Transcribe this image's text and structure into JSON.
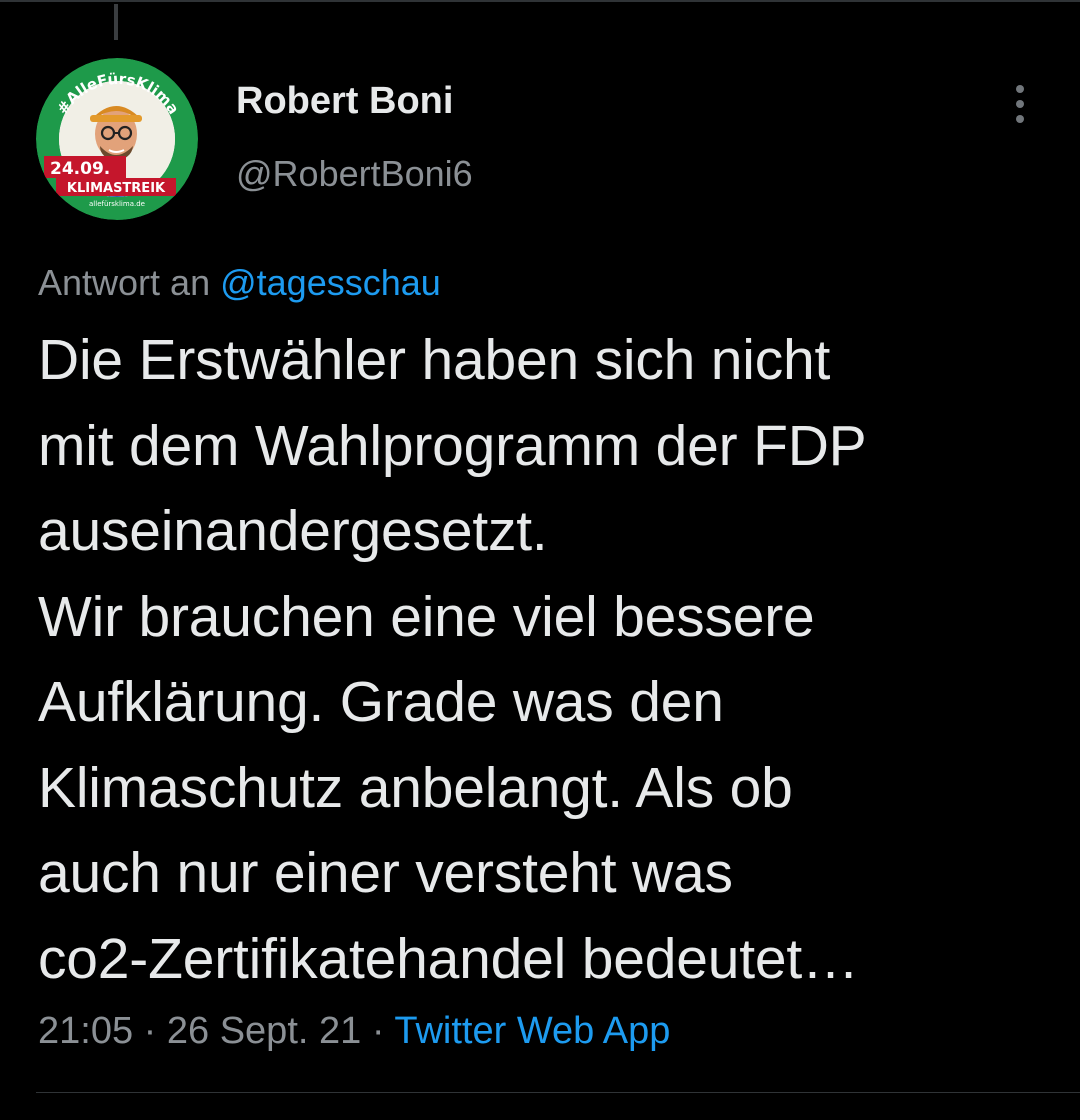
{
  "author": {
    "name": "Robert Boni",
    "handle": "@RobertBoni6",
    "avatar": {
      "badge_text": "#AlleFürsKlima",
      "date_text": "24.09.",
      "strike_text": "KLIMASTREIK",
      "url_text": "allefürsklima.de",
      "ring_color": "#1e9a4a",
      "accent_color": "#c5162c"
    }
  },
  "more_menu": {
    "icon": "more-vertical-icon"
  },
  "reply_context": {
    "prefix": "Antwort an",
    "mention": "@tagesschau"
  },
  "tweet": {
    "lines": [
      "Die Erstwähler haben sich nicht",
      "mit dem Wahlprogramm der FDP",
      "auseinandergesetzt.",
      "Wir brauchen eine viel bessere",
      "Aufklärung. Grade was den",
      "Klimaschutz anbelangt. Als ob",
      "auch nur einer versteht was",
      "co2-Zertifikatehandel bedeutet…"
    ]
  },
  "meta": {
    "time": "21:05",
    "separator": "·",
    "date": "26 Sept. 21",
    "source": "Twitter Web App"
  },
  "colors": {
    "background": "#000000",
    "text_primary": "#e7e9ea",
    "text_secondary": "#8b9095",
    "link": "#1d9bf0"
  }
}
